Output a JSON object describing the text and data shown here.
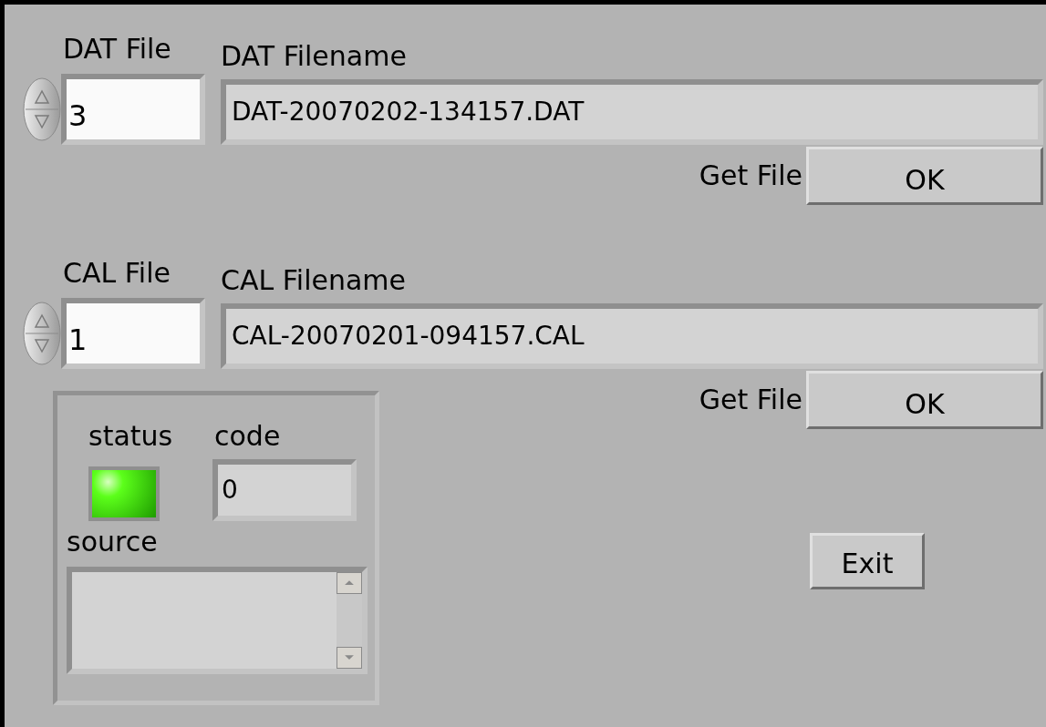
{
  "files": [
    {
      "number_label": "DAT File",
      "number": "3",
      "filename_label": "DAT Filename",
      "filename": "DAT-20070202-134157.DAT",
      "button_label": "Get File",
      "button": "OK"
    },
    {
      "number_label": "CAL File",
      "number": "1",
      "filename_label": "CAL Filename",
      "filename": "CAL-20070201-094157.CAL",
      "button_label": "Get File",
      "button": "OK"
    }
  ],
  "error_cluster": {
    "status_label": "status",
    "status": true,
    "code_label": "code",
    "code": "0",
    "source_label": "source"
  },
  "exit_button": "Exit"
}
